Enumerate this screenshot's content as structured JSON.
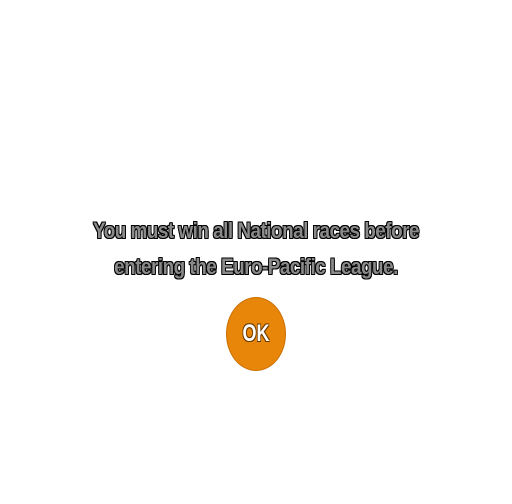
{
  "dialog": {
    "message_line1": "You must win all National races before",
    "message_line2": "entering the Euro-Pacific League.",
    "ok_label": "OK"
  },
  "colors": {
    "background": "#ffffff",
    "button": "#e8860a",
    "text": "#8a8a8a"
  }
}
